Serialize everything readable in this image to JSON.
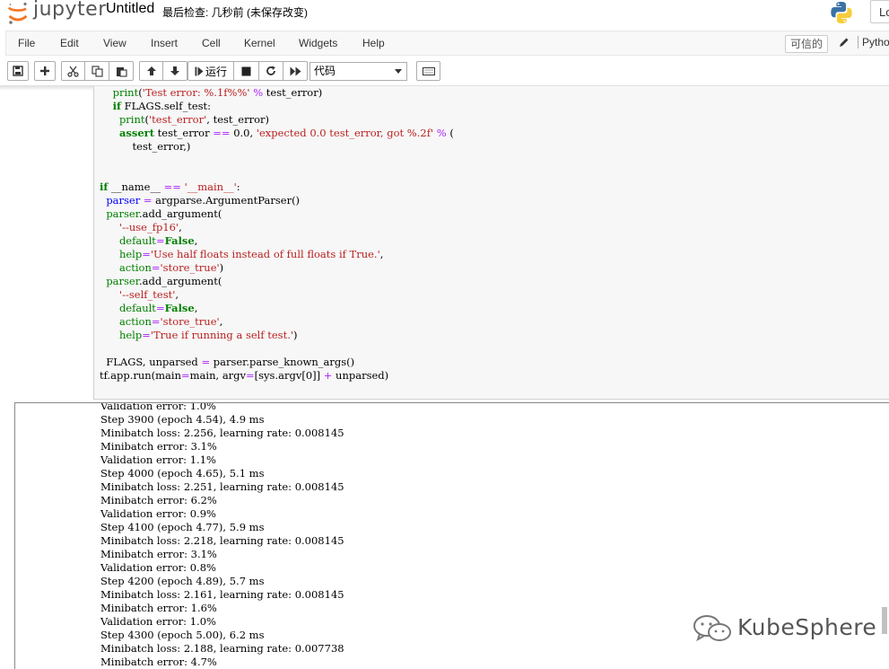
{
  "header": {
    "logo_text": "jupyter",
    "notebook_title": "Untitled",
    "checkpoint": "最后检查: 几秒前  (未保存改变)",
    "logout_label": "Lo"
  },
  "menubar": {
    "items": [
      "File",
      "Edit",
      "View",
      "Insert",
      "Cell",
      "Kernel",
      "Widgets",
      "Help"
    ],
    "trusted": "可信的",
    "kernel": "Pytho"
  },
  "toolbar": {
    "run_label": "运行",
    "cell_type": "代码",
    "icons": [
      "save-icon",
      "plus-icon",
      "cut-icon",
      "copy-icon",
      "paste-icon",
      "arrow-up-icon",
      "arrow-down-icon",
      "run-icon",
      "stop-icon",
      "restart-icon",
      "fast-forward-icon",
      "keyboard-icon"
    ]
  },
  "code_lines": [
    "    print('Test error: %.1f%%' % test_error)",
    "    if FLAGS.self_test:",
    "      print('test_error', test_error)",
    "      assert test_error == 0.0, 'expected 0.0 test_error, got %.2f' % (",
    "          test_error,)",
    "",
    "",
    "if __name__ == '__main__':",
    "  parser = argparse.ArgumentParser()",
    "  parser.add_argument(",
    "      '--use_fp16',",
    "      default=False,",
    "      help='Use half floats instead of full floats if True.',",
    "      action='store_true')",
    "  parser.add_argument(",
    "      '--self_test',",
    "      default=False,",
    "      action='store_true',",
    "      help='True if running a self test.')",
    "",
    "  FLAGS, unparsed = parser.parse_known_args()",
    "tf.app.run(main=main, argv=[sys.argv[0]] + unparsed)"
  ],
  "output_lines": [
    "Validation error: 1.0%",
    "Step 3900 (epoch 4.54), 4.9 ms",
    "Minibatch loss: 2.256, learning rate: 0.008145",
    "Minibatch error: 3.1%",
    "Validation error: 1.1%",
    "Step 4000 (epoch 4.65), 5.1 ms",
    "Minibatch loss: 2.251, learning rate: 0.008145",
    "Minibatch error: 6.2%",
    "Validation error: 0.9%",
    "Step 4100 (epoch 4.77), 5.9 ms",
    "Minibatch loss: 2.218, learning rate: 0.008145",
    "Minibatch error: 3.1%",
    "Validation error: 0.8%",
    "Step 4200 (epoch 4.89), 5.7 ms",
    "Minibatch loss: 2.161, learning rate: 0.008145",
    "Minibatch error: 1.6%",
    "Validation error: 1.0%",
    "Step 4300 (epoch 5.00), 6.2 ms",
    "Minibatch loss: 2.188, learning rate: 0.007738",
    "Minibatch error: 4.7%"
  ],
  "watermark": {
    "text": "KubeSphere"
  },
  "colors": {
    "jupyter_orange": "#f37626",
    "keyword": "#008000",
    "string": "#ba2121",
    "operator": "#aa22ff",
    "cell_bg": "#f7f7f7"
  }
}
